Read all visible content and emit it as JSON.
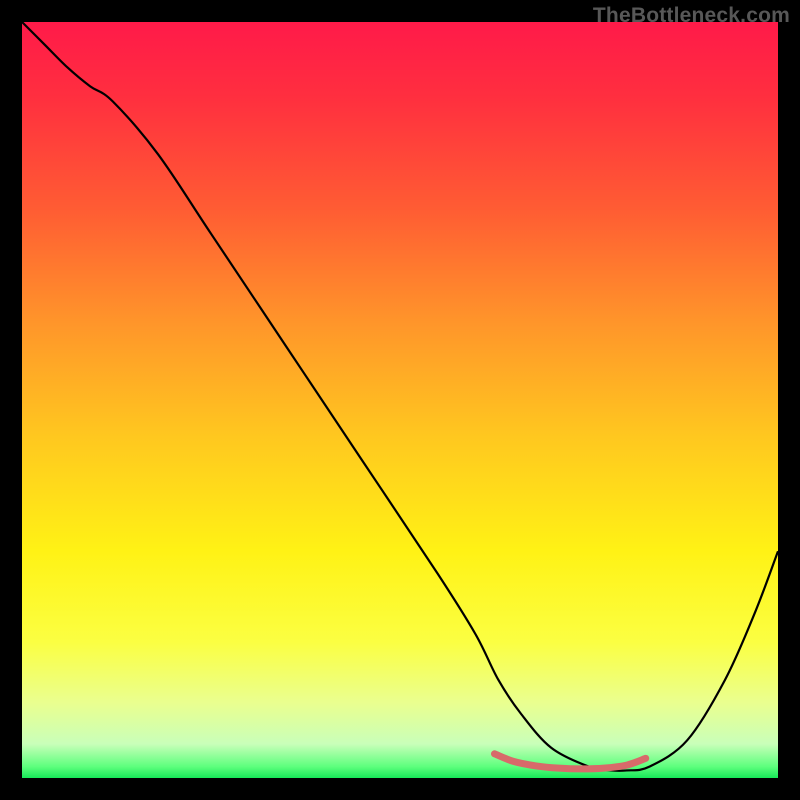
{
  "watermark": "TheBottleneck.com",
  "chart_data": {
    "type": "line",
    "title": "",
    "xlabel": "",
    "ylabel": "",
    "xlim": [
      0,
      100
    ],
    "ylim": [
      0,
      100
    ],
    "gradient_stops": [
      {
        "offset": 0.0,
        "color": "#ff1a49"
      },
      {
        "offset": 0.1,
        "color": "#ff2f3f"
      },
      {
        "offset": 0.25,
        "color": "#ff5d33"
      },
      {
        "offset": 0.4,
        "color": "#ff962a"
      },
      {
        "offset": 0.55,
        "color": "#ffc81f"
      },
      {
        "offset": 0.7,
        "color": "#fff215"
      },
      {
        "offset": 0.82,
        "color": "#fbff42"
      },
      {
        "offset": 0.9,
        "color": "#eaff8f"
      },
      {
        "offset": 0.955,
        "color": "#c9ffb9"
      },
      {
        "offset": 0.985,
        "color": "#5dff7d"
      },
      {
        "offset": 1.0,
        "color": "#17e858"
      }
    ],
    "series": [
      {
        "name": "bottleneck-curve",
        "type": "line",
        "color": "#000000",
        "x": [
          0.0,
          3.0,
          6.0,
          9.0,
          12.0,
          18.0,
          25.0,
          35.0,
          45.0,
          55.0,
          60.0,
          63.0,
          66.0,
          70.0,
          75.0,
          78.0,
          80.0,
          83.0,
          88.0,
          93.0,
          97.0,
          100.0
        ],
        "values": [
          100.0,
          97.0,
          94.0,
          91.5,
          89.5,
          82.5,
          72.0,
          57.0,
          42.0,
          27.0,
          19.0,
          13.0,
          8.5,
          4.0,
          1.5,
          1.0,
          1.0,
          1.5,
          5.0,
          13.0,
          22.0,
          30.0
        ]
      },
      {
        "name": "bottom-highlight",
        "type": "line",
        "color": "#d86a6a",
        "stroke_width": 7,
        "x": [
          62.5,
          65.0,
          68.0,
          71.0,
          74.0,
          77.0,
          80.0,
          82.5
        ],
        "values": [
          3.2,
          2.2,
          1.6,
          1.3,
          1.2,
          1.3,
          1.7,
          2.6
        ]
      }
    ]
  }
}
